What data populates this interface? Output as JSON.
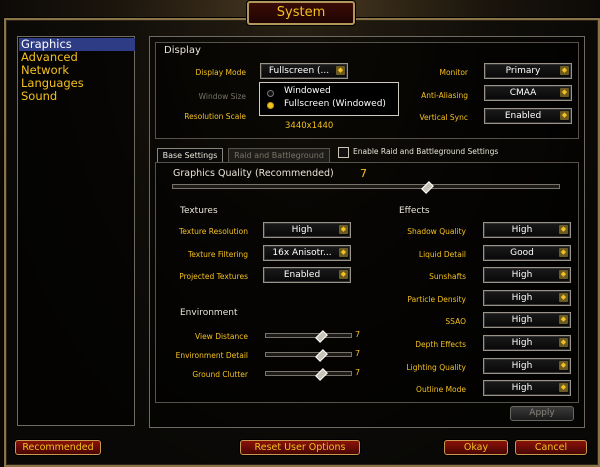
{
  "window": {
    "title": "System"
  },
  "categories": [
    "Graphics",
    "Advanced",
    "Network",
    "Languages",
    "Sound"
  ],
  "display": {
    "header": "Display",
    "display_mode": {
      "label": "Display Mode",
      "value": "Fullscreen (..."
    },
    "window_size": {
      "label": "Window Size"
    },
    "resolution_scale": {
      "label": "Resolution Scale",
      "value": "3440x1440"
    },
    "monitor": {
      "label": "Monitor",
      "value": "Primary"
    },
    "anti_aliasing": {
      "label": "Anti-Aliasing",
      "value": "CMAA"
    },
    "vertical_sync": {
      "label": "Vertical Sync",
      "value": "Enabled"
    },
    "mode_options": [
      "Windowed",
      "Fullscreen (Windowed)"
    ],
    "selected_mode_index": 1
  },
  "tabs": {
    "base": "Base Settings",
    "raid": "Raid and Battleground",
    "enable_raid_label": "Enable Raid and Battleground Settings"
  },
  "quality": {
    "label": "Graphics Quality (Recommended)",
    "value": "7",
    "level_fraction": 0.66
  },
  "textures": {
    "header": "Textures",
    "items": [
      {
        "label": "Texture Resolution",
        "value": "High"
      },
      {
        "label": "Texture Filtering",
        "value": "16x Anisotr..."
      },
      {
        "label": "Projected Textures",
        "value": "Enabled"
      }
    ]
  },
  "environment": {
    "header": "Environment",
    "items": [
      {
        "label": "View Distance",
        "value": "7",
        "fraction": 0.66
      },
      {
        "label": "Environment Detail",
        "value": "7",
        "fraction": 0.66
      },
      {
        "label": "Ground Clutter",
        "value": "7",
        "fraction": 0.66
      }
    ]
  },
  "effects": {
    "header": "Effects",
    "items": [
      {
        "label": "Shadow Quality",
        "value": "High"
      },
      {
        "label": "Liquid Detail",
        "value": "Good"
      },
      {
        "label": "Sunshafts",
        "value": "High"
      },
      {
        "label": "Particle Density",
        "value": "High"
      },
      {
        "label": "SSAO",
        "value": "High"
      },
      {
        "label": "Depth Effects",
        "value": "High"
      },
      {
        "label": "Lighting Quality",
        "value": "High"
      },
      {
        "label": "Outline Mode",
        "value": "High"
      }
    ]
  },
  "buttons": {
    "apply": "Apply",
    "recommended": "Recommended",
    "reset": "Reset User Options",
    "okay": "Okay",
    "cancel": "Cancel"
  },
  "colors": {
    "accent_gold": "#f4c01f",
    "selection_blue": "#2e3c86",
    "button_red": "#8a1208"
  }
}
